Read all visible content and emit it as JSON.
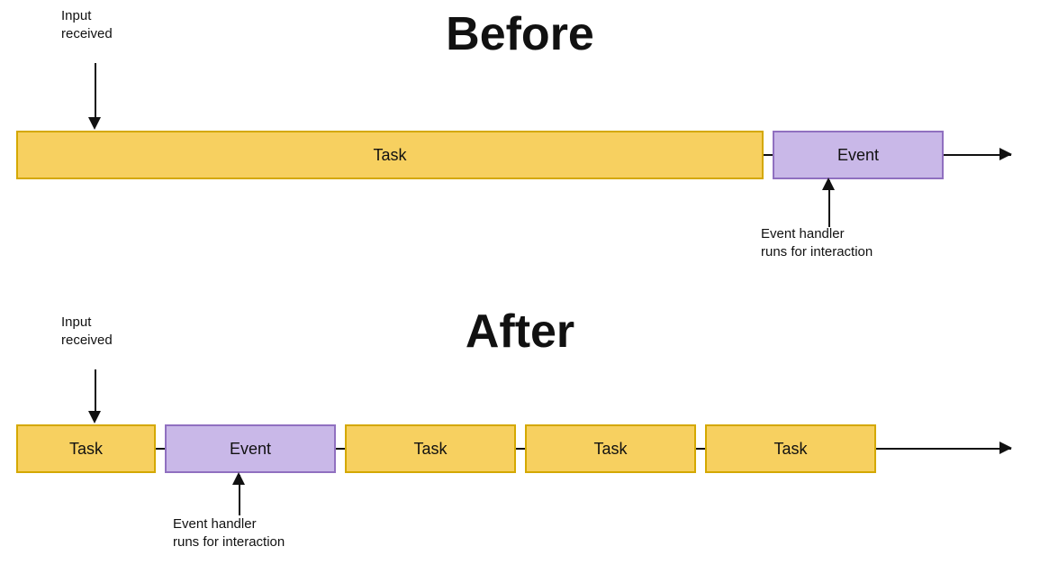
{
  "before": {
    "title": "Before",
    "input_label": "Input\nreceived",
    "task_label": "Task",
    "event_label": "Event",
    "annotation": "Event handler\nruns for interaction"
  },
  "after": {
    "title": "After",
    "input_label": "Input\nreceived",
    "task_label": "Task",
    "event_label": "Event",
    "annotation": "Event handler\nruns for interaction"
  }
}
